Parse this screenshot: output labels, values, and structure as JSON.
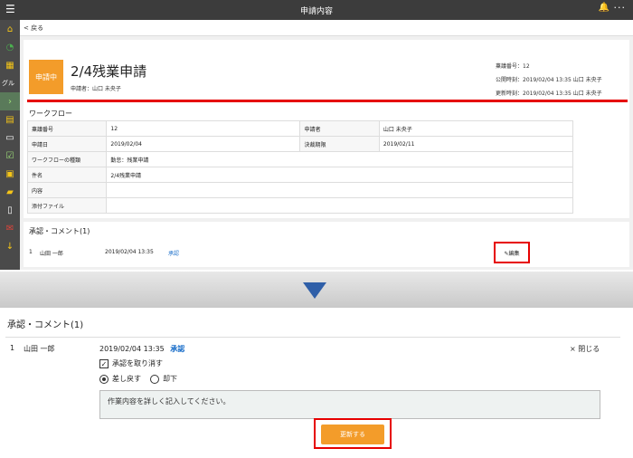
{
  "header": {
    "title": "申請内容",
    "menu_icon": "hamburger-icon",
    "bell_icon": "bell-icon",
    "more_icon": "more-icon"
  },
  "sidebar": {
    "items": [
      {
        "icon": "home-icon",
        "glyph": "⌂",
        "color": "#f5c518"
      },
      {
        "icon": "pie-chart-icon",
        "glyph": "◔",
        "color": "#4caf50"
      },
      {
        "icon": "shop-icon",
        "glyph": "▦",
        "color": "#f5c518"
      },
      {
        "icon": "group-label",
        "label": "グル"
      },
      {
        "icon": "chevron-right-icon",
        "glyph": "›",
        "color": "#9fe07a"
      },
      {
        "icon": "timecard-icon",
        "glyph": "▤",
        "color": "#f5c518"
      },
      {
        "icon": "card-icon",
        "glyph": "▭",
        "color": "#ffffff"
      },
      {
        "icon": "check-list-icon",
        "glyph": "☑",
        "color": "#9fe07a"
      },
      {
        "icon": "mail-card-icon",
        "glyph": "▣",
        "color": "#f5c518"
      },
      {
        "icon": "folder-icon",
        "glyph": "▰",
        "color": "#f5c518"
      },
      {
        "icon": "document-icon",
        "glyph": "▯",
        "color": "#ffffff"
      },
      {
        "icon": "mail-icon",
        "glyph": "✉",
        "color": "#e0443a"
      },
      {
        "icon": "pin-icon",
        "glyph": "↓",
        "color": "#f5c518"
      }
    ]
  },
  "back": {
    "label": "< 戻る"
  },
  "request": {
    "status": "申請中",
    "title": "2/4残業申請",
    "applicant": "申請者：山口 未央子",
    "number_line": "稟議番号：12",
    "published_line": "公開時刻：2019/02/04 13:35 山口 未央子",
    "updated_line": "更新時刻：2019/02/04 13:35 山口 未央子"
  },
  "workflow": {
    "title": "ワークフロー",
    "rows": [
      [
        "稟議番号",
        "12",
        "申請者",
        "山口 未央子"
      ],
      [
        "申請日",
        "2019/02/04",
        "決裁期限",
        "2019/02/11"
      ],
      [
        "ワークフローの種類",
        "勤怠：残業申請"
      ],
      [
        "件名",
        "2/4残業申請"
      ],
      [
        "内容",
        ""
      ],
      [
        "添付ファイル",
        ""
      ]
    ]
  },
  "comments": {
    "title": "承認・コメント(1)",
    "row": {
      "num": "1",
      "name": "山田 一郎",
      "date": "2019/02/04 13:35",
      "action": "承認"
    },
    "edit_label": "✎編集"
  },
  "arrow_color": "#2f5fa8",
  "detail": {
    "title": "承認・コメント(1)",
    "num": "1",
    "name": "山田 一郎",
    "date": "2019/02/04 13:35",
    "action": "承認",
    "close_label": "× 閉じる",
    "cancel_approval_label": "承認を取り消す",
    "cancel_approval_checked": true,
    "radio_options": [
      "差し戻す",
      "却下"
    ],
    "radio_selected": "差し戻す",
    "textarea_value": "作業内容を詳しく記入してください。",
    "update_label": "更新する"
  },
  "colors": {
    "accent": "#f39c2a",
    "highlight": "#e60000",
    "link": "#1a6ec9"
  }
}
